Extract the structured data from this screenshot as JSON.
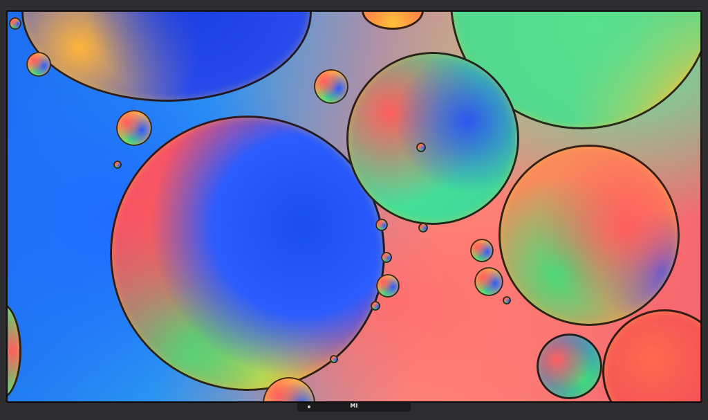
{
  "tv": {
    "brand_logo": "MI"
  }
}
